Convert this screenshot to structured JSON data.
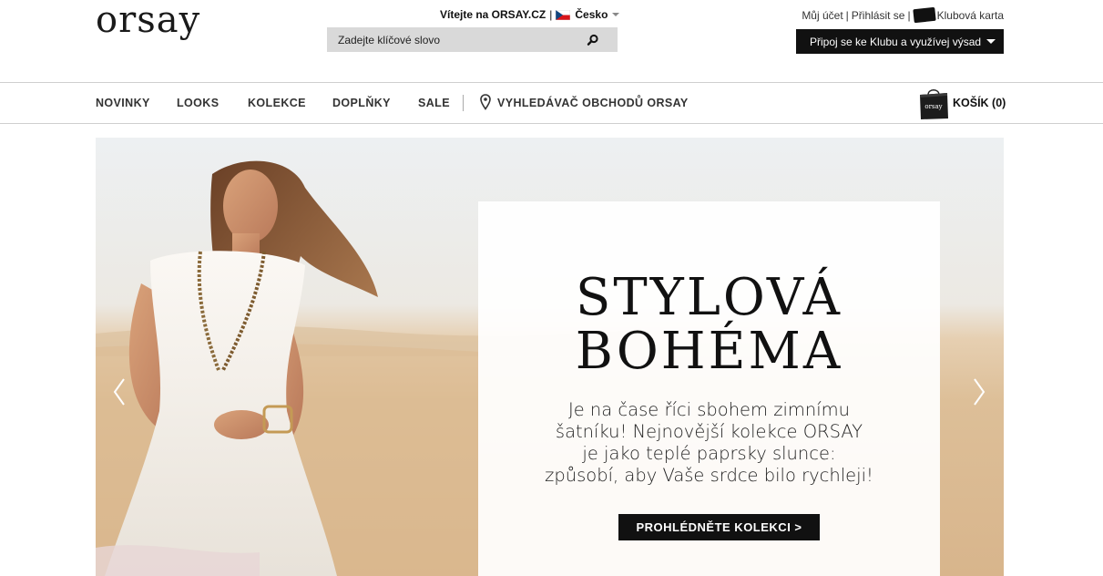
{
  "header": {
    "logo_text": "orsay",
    "welcome_text": "Vítejte na ORSAY.CZ",
    "welcome_separator": "|",
    "country": "Česko",
    "search_placeholder": "Zadejte klíčové slovo",
    "account": {
      "my_account": "Můj účet",
      "login": "Přihlásit se",
      "club_card": "Klubová karta",
      "separator": "|"
    },
    "club_button": "Připoj se ke Klubu a využívej výsad"
  },
  "nav": {
    "items": [
      {
        "label": "NOVINKY"
      },
      {
        "label": "LOOKS"
      },
      {
        "label": "KOLEKCE"
      },
      {
        "label": "DOPLŇKY"
      },
      {
        "label": "SALE"
      }
    ],
    "store_finder": "VYHLEDÁVAČ OBCHODŮ ORSAY",
    "cart": "KOŠÍK (0)",
    "bag_logo": "orsay"
  },
  "hero": {
    "title_line1": "STYLOVÁ",
    "title_line2": "BOHÉMA",
    "text_line1": "Je na čase říci sbohem zimnímu",
    "text_line2": "šatníku! Nejnovější kolekce ORSAY",
    "text_line3": "je jako teplé paprsky slunce:",
    "text_line4": "způsobí, aby Vaše srdce bilo rychleji!",
    "cta": "PROHLÉDNĚTE KOLEKCI >"
  },
  "colors": {
    "black": "#111111",
    "search_bg": "#d9d9d9",
    "sand": "#d8b58c"
  },
  "icons": [
    "search-icon",
    "czech-flag-icon",
    "chevron-down-icon",
    "club-card-icon",
    "location-pin-icon",
    "shopping-bag-icon",
    "arrow-left-icon",
    "arrow-right-icon"
  ]
}
